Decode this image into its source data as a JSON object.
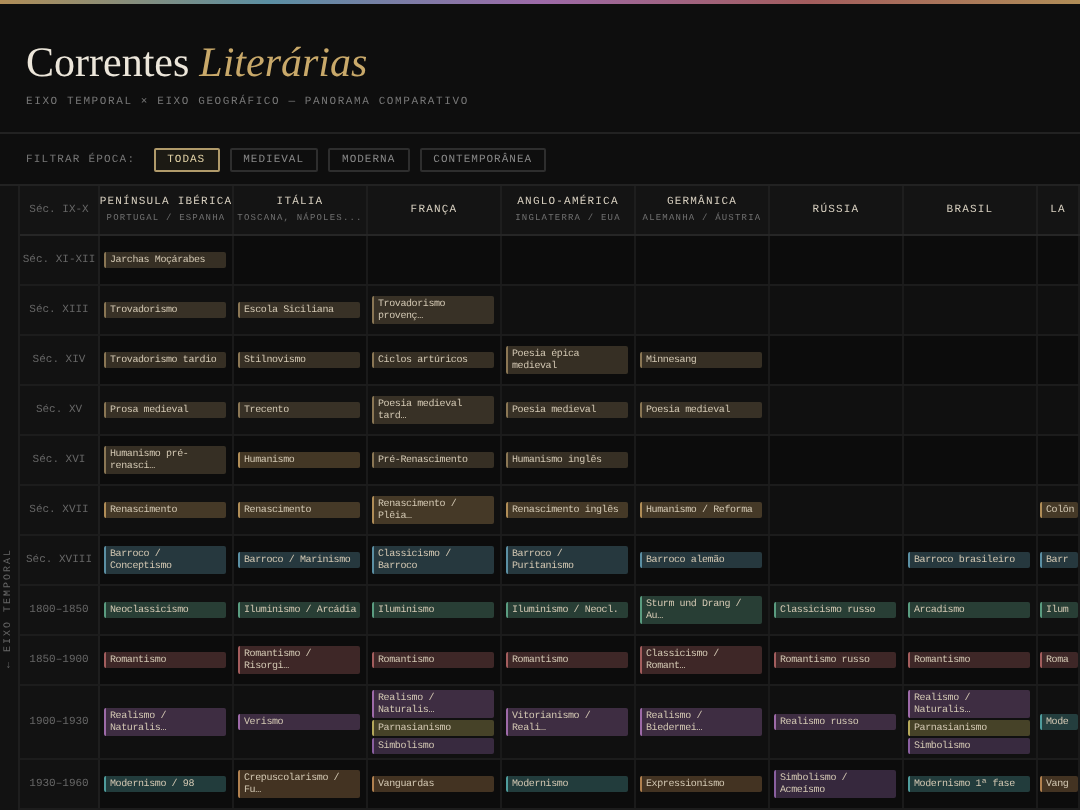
{
  "header": {
    "title": "Correntes",
    "title_accent": "Literárias",
    "subtitle": "EIXO TEMPORAL × EIXO GEOGRÁFICO — PANORAMA COMPARATIVO"
  },
  "filter": {
    "label": "FILTRAR ÉPOCA:",
    "options": [
      {
        "label": "TODAS",
        "selected": true
      },
      {
        "label": "MEDIEVAL",
        "selected": false
      },
      {
        "label": "MODERNA",
        "selected": false
      },
      {
        "label": "CONTEMPORÂNEA",
        "selected": false
      }
    ]
  },
  "axis_label": "← EIXO TEMPORAL",
  "table": {
    "columns": [
      {
        "name": "PENÍNSULA IBÉRICA",
        "sub": "PORTUGAL / ESPANHA"
      },
      {
        "name": "ITÁLIA",
        "sub": "TOSCANA, NÁPOLES..."
      },
      {
        "name": "FRANÇA"
      },
      {
        "name": "ANGLO-AMÉRICA",
        "sub": "INGLATERRA / EUA"
      },
      {
        "name": "GERMÂNICA",
        "sub": "ALEMANHA / ÁUSTRIA"
      },
      {
        "name": "RÚSSIA"
      },
      {
        "name": "BRASIL"
      },
      {
        "name": "LA"
      }
    ],
    "rows": [
      {
        "label": "Séc. IX-X"
      },
      {
        "label": "Séc. XI-XII",
        "cells": [
          [
            {
              "text": "Jarchas Moçárabes",
              "color": "#8a7654"
            }
          ],
          null,
          null,
          null,
          null,
          null,
          null,
          null
        ]
      },
      {
        "label": "Séc. XIII",
        "cells": [
          [
            {
              "text": "Trovadorismo",
              "color": "#8a7654"
            }
          ],
          [
            {
              "text": "Escola Siciliana",
              "color": "#8a7654"
            }
          ],
          [
            {
              "text": "Trovadorismo provenç…",
              "color": "#8a7654"
            }
          ],
          null,
          null,
          null,
          null,
          null
        ]
      },
      {
        "label": "Séc. XIV",
        "cells": [
          [
            {
              "text": "Trovadorismo tardio",
              "color": "#8a7654"
            }
          ],
          [
            {
              "text": "Stilnovismo",
              "color": "#8a7654"
            }
          ],
          [
            {
              "text": "Ciclos artúricos",
              "color": "#8a7654"
            }
          ],
          [
            {
              "text": "Poesia épica medieval",
              "color": "#8a7654"
            }
          ],
          [
            {
              "text": "Minnesang",
              "color": "#8a7654"
            }
          ],
          null,
          null,
          null
        ]
      },
      {
        "label": "Séc. XV",
        "cells": [
          [
            {
              "text": "Prosa medieval",
              "color": "#8a7654"
            }
          ],
          [
            {
              "text": "Trecento",
              "color": "#8a7654"
            }
          ],
          [
            {
              "text": "Poesia medieval tard…",
              "color": "#8a7654"
            }
          ],
          [
            {
              "text": "Poesia medieval",
              "color": "#8a7654"
            }
          ],
          [
            {
              "text": "Poesia medieval",
              "color": "#8a7654"
            }
          ],
          null,
          null,
          null
        ]
      },
      {
        "label": "Séc. XVI",
        "cells": [
          [
            {
              "text": "Humanismo pré-renasci…",
              "color": "#8a7654"
            }
          ],
          [
            {
              "text": "Humanismo",
              "color": "#b08d57"
            }
          ],
          [
            {
              "text": "Pré-Renascimento",
              "color": "#8a7654"
            }
          ],
          [
            {
              "text": "Humanismo inglês",
              "color": "#8a7654"
            }
          ],
          null,
          null,
          null,
          null
        ]
      },
      {
        "label": "Séc. XVII",
        "cells": [
          [
            {
              "text": "Renascimento",
              "color": "#b08d57"
            }
          ],
          [
            {
              "text": "Renascimento",
              "color": "#b08d57"
            }
          ],
          [
            {
              "text": "Renascimento / Plêia…",
              "color": "#b08d57"
            }
          ],
          [
            {
              "text": "Renascimento inglês",
              "color": "#b08d57"
            }
          ],
          [
            {
              "text": "Humanismo / Reforma",
              "color": "#b08d57"
            }
          ],
          null,
          null,
          [
            {
              "text": "Colôn",
              "color": "#b08d57"
            }
          ]
        ]
      },
      {
        "label": "Séc. XVIII",
        "cells": [
          [
            {
              "text": "Barroco / Conceptismo",
              "color": "#5b8fa3"
            }
          ],
          [
            {
              "text": "Barroco / Marinismo",
              "color": "#5b8fa3"
            }
          ],
          [
            {
              "text": "Classicismo / Barroco",
              "color": "#5b8fa3"
            }
          ],
          [
            {
              "text": "Barroco / Puritanismo",
              "color": "#5b8fa3"
            }
          ],
          [
            {
              "text": "Barroco alemão",
              "color": "#5b8fa3"
            }
          ],
          null,
          [
            {
              "text": "Barroco brasileiro",
              "color": "#5b8fa3"
            }
          ],
          [
            {
              "text": "Barr",
              "color": "#5b8fa3"
            }
          ]
        ]
      },
      {
        "label": "1800–1850",
        "cells": [
          [
            {
              "text": "Neoclassicismo",
              "color": "#5a9c80"
            }
          ],
          [
            {
              "text": "Iluminismo / Arcádia",
              "color": "#5a9c80"
            }
          ],
          [
            {
              "text": "Iluminismo",
              "color": "#5a9c80"
            }
          ],
          [
            {
              "text": "Iluminismo / Neocl.",
              "color": "#5a9c80"
            }
          ],
          [
            {
              "text": "Sturm und Drang / Au…",
              "color": "#5a9c80"
            }
          ],
          [
            {
              "text": "Classicismo russo",
              "color": "#5a9c80"
            }
          ],
          [
            {
              "text": "Arcadismo",
              "color": "#5a9c80"
            }
          ],
          [
            {
              "text": "Ilum",
              "color": "#5a9c80"
            }
          ]
        ]
      },
      {
        "label": "1850–1900",
        "cells": [
          [
            {
              "text": "Romantismo",
              "color": "#a35d5d"
            }
          ],
          [
            {
              "text": "Romantismo / Risorgi…",
              "color": "#a35d5d"
            }
          ],
          [
            {
              "text": "Romantismo",
              "color": "#a35d5d"
            }
          ],
          [
            {
              "text": "Romantismo",
              "color": "#a35d5d"
            }
          ],
          [
            {
              "text": "Classicismo / Romant…",
              "color": "#a35d5d"
            }
          ],
          [
            {
              "text": "Romantismo russo",
              "color": "#a35d5d"
            }
          ],
          [
            {
              "text": "Romantismo",
              "color": "#a35d5d"
            }
          ],
          [
            {
              "text": "Roma",
              "color": "#a35d5d"
            }
          ]
        ]
      },
      {
        "label": "1900–1930",
        "cells": [
          [
            {
              "text": "Realismo / Naturalis…",
              "color": "#9d6aa8"
            }
          ],
          [
            {
              "text": "Verismo",
              "color": "#9d6aa8"
            }
          ],
          [
            {
              "text": "Realismo / Naturalis…",
              "color": "#9d6aa8"
            },
            {
              "text": "Parnasianismo",
              "color": "#b5a85a"
            },
            {
              "text": "Simbolismo",
              "color": "#8a5fa0"
            }
          ],
          [
            {
              "text": "Vitorianismo / Reali…",
              "color": "#9d6aa8"
            }
          ],
          [
            {
              "text": "Realismo / Biedermei…",
              "color": "#9d6aa8"
            }
          ],
          [
            {
              "text": "Realismo russo",
              "color": "#9d6aa8"
            }
          ],
          [
            {
              "text": "Realismo / Naturalis…",
              "color": "#9d6aa8"
            },
            {
              "text": "Parnasianismo",
              "color": "#b5a85a"
            },
            {
              "text": "Simbolismo",
              "color": "#8a5fa0"
            }
          ],
          [
            {
              "text": "Mode",
              "color": "#4f9c9c"
            }
          ]
        ]
      },
      {
        "label": "1930–1960",
        "cells": [
          [
            {
              "text": "Modernismo / 98",
              "color": "#4f9c9c"
            }
          ],
          [
            {
              "text": "Crepuscolarismo / Fu…",
              "color": "#b0804f"
            }
          ],
          [
            {
              "text": "Vanguardas",
              "color": "#b0804f"
            }
          ],
          [
            {
              "text": "Modernismo",
              "color": "#4f9c9c"
            }
          ],
          [
            {
              "text": "Expressionismo",
              "color": "#b0804f"
            }
          ],
          [
            {
              "text": "Simbolismo / Acmeísmo",
              "color": "#8a5fa0"
            }
          ],
          [
            {
              "text": "Modernismo 1ª fase",
              "color": "#4f9c9c"
            }
          ],
          [
            {
              "text": "Vang",
              "color": "#b0804f"
            }
          ]
        ]
      }
    ]
  }
}
